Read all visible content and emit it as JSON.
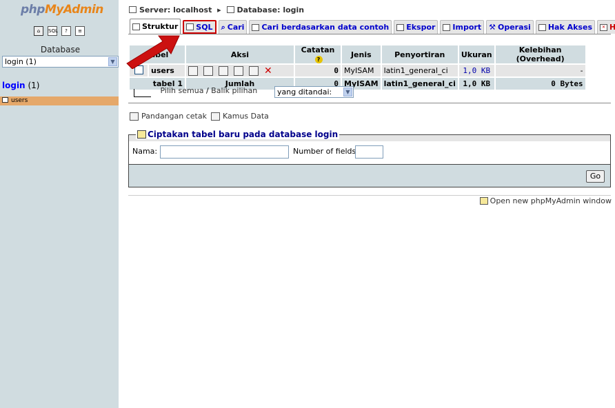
{
  "logo": {
    "part1": "php",
    "part2": "MyAdmin"
  },
  "left": {
    "db_label": "Database",
    "db_select": "login (1)",
    "db_link": "login",
    "db_count": "(1)",
    "table_item": "users"
  },
  "breadcrumb": {
    "server": "Server: localhost",
    "sep": "▸",
    "database": "Database: login"
  },
  "tabs": [
    {
      "label": "Struktur"
    },
    {
      "label": "SQL"
    },
    {
      "label": "Cari"
    },
    {
      "label": "Cari berdasarkan data contoh"
    },
    {
      "label": "Ekspor"
    },
    {
      "label": "Import"
    },
    {
      "label": "Operasi"
    },
    {
      "label": "Hak Akses"
    },
    {
      "label": "Hapus"
    }
  ],
  "table": {
    "headers": [
      "Tabel",
      "Aksi",
      "Catatan",
      "Jenis",
      "Penyortiran",
      "Ukuran",
      "Kelebihan (Overhead)"
    ],
    "rows": [
      {
        "name": "users",
        "records": "0",
        "type": "MyISAM",
        "collation": "latin1_general_ci",
        "size": "1,0 KB",
        "overhead": "-"
      }
    ],
    "summary": {
      "name": "tabel 1",
      "label": "Jumlah",
      "records": "0",
      "type": "MyISAM",
      "collation": "latin1_general_ci",
      "size": "1,0 KB",
      "overhead": "0 Bytes"
    }
  },
  "select_all": {
    "check_all": "Pilih semua",
    "sep": " / ",
    "invert": "Balik pilihan",
    "with_selected": "yang ditandai:"
  },
  "links": {
    "print_view": "Pandangan cetak",
    "data_dictionary": "Kamus Data"
  },
  "create": {
    "legend": "Ciptakan tabel baru pada database login",
    "name_label": "Nama:",
    "name_value": "",
    "fields_label": "Number of fields:",
    "fields_value": "",
    "go": "Go"
  },
  "footer": {
    "new_window": "Open new phpMyAdmin window"
  },
  "colors": {
    "accent_red": "#cc0000",
    "header_bg": "#d0dce0",
    "row_bg": "#e5e5e5"
  }
}
